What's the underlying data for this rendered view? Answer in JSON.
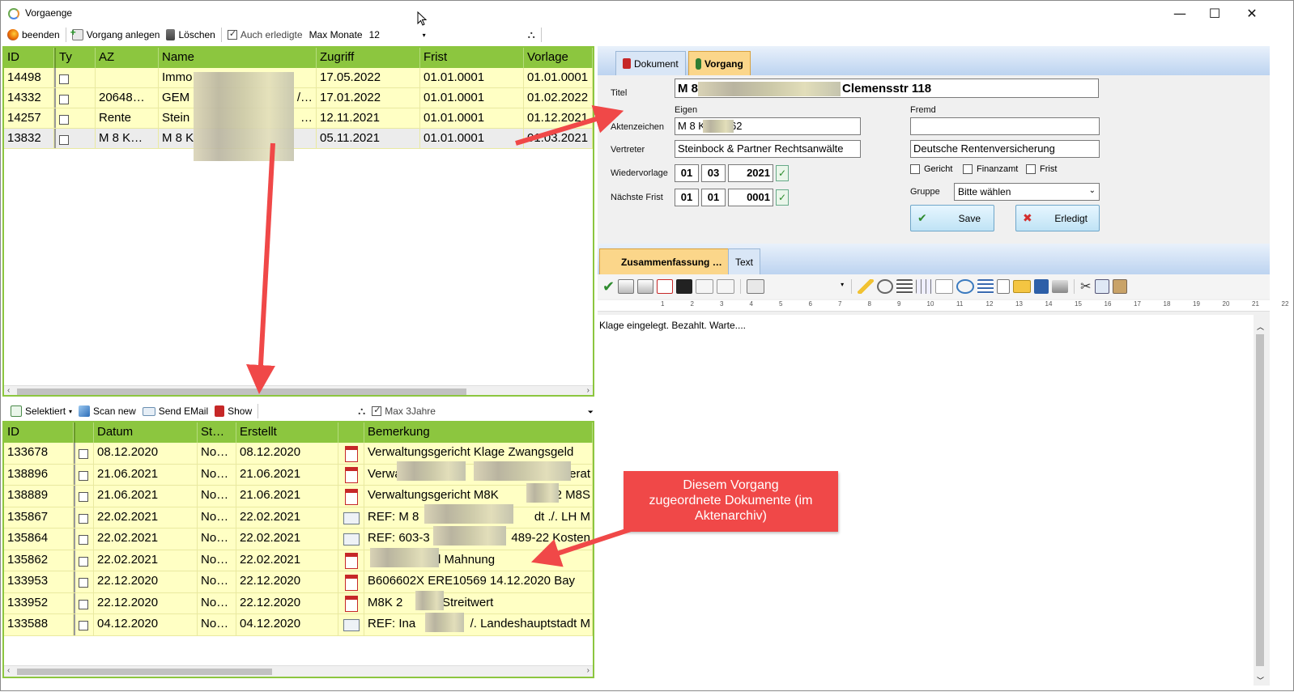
{
  "window": {
    "title": "Vorgaenge",
    "minimize": "—",
    "maximize": "☐",
    "close": "✕"
  },
  "top_toolbar": {
    "beenden": "beenden",
    "vorgang_anlegen": "Vorgang anlegen",
    "loeschen": "Löschen",
    "auch_erledigte": "Auch erledigte",
    "max_monate_label": "Max Monate",
    "max_monate_value": "12"
  },
  "vorgaenge_grid": {
    "columns": [
      "ID",
      "Ty",
      "AZ",
      "Name",
      "Zugriff",
      "Frist",
      "Vorlage"
    ],
    "rows": [
      {
        "id": "14498",
        "az": "",
        "name": "Immo",
        "zugriff": "17.05.2022",
        "frist": "01.01.0001",
        "vorlage": "01.01.0001"
      },
      {
        "id": "14332",
        "az": "20648…",
        "name": "GEM",
        "name_tail": "/…",
        "zugriff": "17.01.2022",
        "frist": "01.01.0001",
        "vorlage": "01.02.2022"
      },
      {
        "id": "14257",
        "az": "Rente",
        "name": "Stein",
        "name_tail": "…",
        "zugriff": "12.11.2021",
        "frist": "01.01.0001",
        "vorlage": "01.12.2021"
      },
      {
        "id": "13832",
        "az": "M 8 K…",
        "name": "M 8 K",
        "zugriff": "05.11.2021",
        "frist": "01.01.0001",
        "vorlage": "01.03.2021"
      }
    ]
  },
  "doc_toolbar": {
    "selektiert": "Selektiert",
    "scan_new": "Scan new",
    "send_email": "Send EMail",
    "show": "Show",
    "max_3jahre": "Max 3Jahre"
  },
  "docs_grid": {
    "columns": [
      "ID",
      "",
      "Datum",
      "St…",
      "Erstellt",
      "",
      "Bemerkung"
    ],
    "rows": [
      {
        "id": "133678",
        "datum": "08.12.2020",
        "st": "No…",
        "erstellt": "08.12.2020",
        "type": "pdf",
        "bemerkung": "Verwaltungsgericht Klage Zwangsgeld"
      },
      {
        "id": "138896",
        "datum": "21.06.2021",
        "st": "No…",
        "erstellt": "21.06.2021",
        "type": "pdf",
        "bemerkung": "Verwal",
        "bemerkung_tail": "eferat"
      },
      {
        "id": "138889",
        "datum": "21.06.2021",
        "st": "No…",
        "erstellt": "21.06.2021",
        "type": "pdf",
        "bemerkung": "Verwaltungsgericht  M8K",
        "bemerkung_tail": "2  M8S"
      },
      {
        "id": "135867",
        "datum": "22.02.2021",
        "st": "No…",
        "erstellt": "22.02.2021",
        "type": "mail",
        "bemerkung": "REF:  M 8",
        "bemerkung_tail": "dt ./.  LH M"
      },
      {
        "id": "135864",
        "datum": "22.02.2021",
        "st": "No…",
        "erstellt": "22.02.2021",
        "type": "mail",
        "bemerkung": "REF:  603-3",
        "bemerkung_tail": "489-22  Kosten"
      },
      {
        "id": "135862",
        "datum": "22.02.2021",
        "st": "No…",
        "erstellt": "22.02.2021",
        "type": "pdf",
        "bemerkung": "",
        "bemerkung_tail": "d Mahnung"
      },
      {
        "id": "133953",
        "datum": "22.12.2020",
        "st": "No…",
        "erstellt": "22.12.2020",
        "type": "pdf",
        "bemerkung": "B606602X  ERE10569  14.12.2020  Bay"
      },
      {
        "id": "133952",
        "datum": "22.12.2020",
        "st": "No…",
        "erstellt": "22.12.2020",
        "type": "pdf",
        "bemerkung": "M8K 2",
        "bemerkung_tail": "Streitwert"
      },
      {
        "id": "133588",
        "datum": "04.12.2020",
        "st": "No…",
        "erstellt": "04.12.2020",
        "type": "mail",
        "bemerkung": "REF:  Ina",
        "bemerkung_tail": "/.  Landeshauptstadt M"
      }
    ]
  },
  "detail": {
    "tabs": [
      "Dokument",
      "Vorgang"
    ],
    "titel_label": "Titel",
    "titel_value_start": "M 8",
    "titel_value_end": "Clemensstr 118",
    "eigen_label": "Eigen",
    "fremd_label": "Fremd",
    "aktenzeichen_label": "Aktenzeichen",
    "aktenzeichen_eigen_start": "M 8 K",
    "aktenzeichen_eigen_end": "62",
    "aktenzeichen_fremd": "",
    "vertreter_label": "Vertreter",
    "vertreter_eigen": "Steinbock & Partner Rechtsanwälte",
    "vertreter_fremd": "Deutsche Rentenversicherung",
    "wiedervorlage_label": "Wiedervorlage",
    "wiedervorlage": {
      "day": "01",
      "month": "03",
      "year": "2021"
    },
    "naechste_frist_label": "Nächste Frist",
    "naechste_frist": {
      "day": "01",
      "month": "01",
      "year": "0001"
    },
    "gericht": "Gericht",
    "finanzamt": "Finanzamt",
    "frist": "Frist",
    "gruppe_label": "Gruppe",
    "gruppe_value": "Bitte wählen",
    "save": "Save",
    "erledigt": "Erledigt"
  },
  "notes": {
    "tabs": [
      "Zusammenfassung …",
      "Text"
    ],
    "content": "Klage eingelegt. Bezahlt. Warte....",
    "ruler": [
      "1",
      "2",
      "3",
      "4",
      "5",
      "6",
      "7",
      "8",
      "9",
      "10",
      "11",
      "12",
      "13",
      "14",
      "15",
      "16",
      "17",
      "18",
      "19",
      "20",
      "21",
      "22"
    ]
  },
  "callout": {
    "lines": [
      "Diesem Vorgang",
      "zugeordnete Dokumente (im",
      "Aktenarchiv)"
    ]
  }
}
